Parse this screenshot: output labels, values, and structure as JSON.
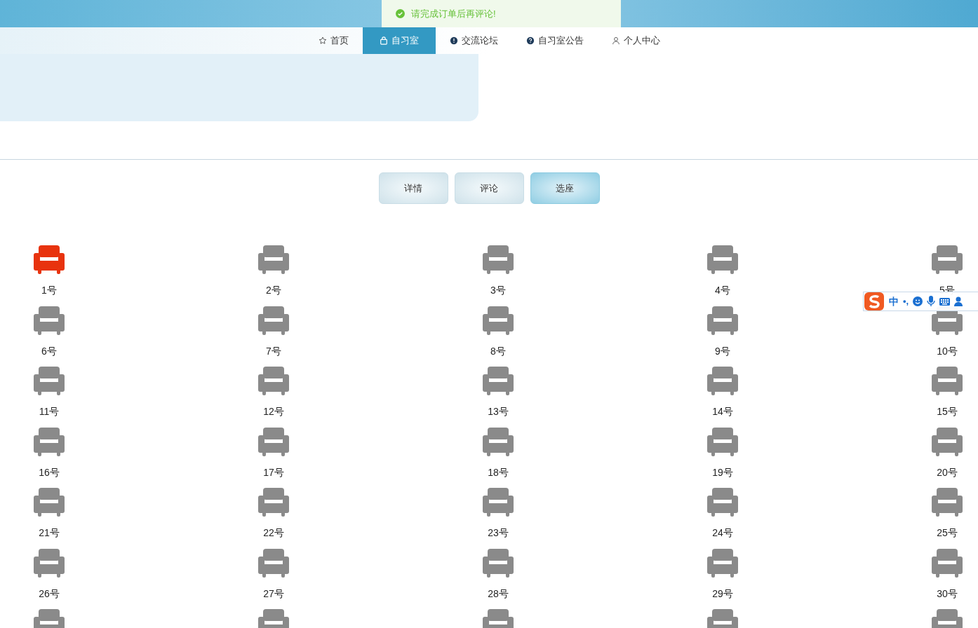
{
  "toast": {
    "message": "请完成订单后再评论!"
  },
  "nav": [
    {
      "label": "首页",
      "kind": "star",
      "selected": false
    },
    {
      "label": "自习室",
      "kind": "bag",
      "selected": true
    },
    {
      "label": "交流论坛",
      "kind": "alert",
      "selected": false
    },
    {
      "label": "自习室公告",
      "kind": "help",
      "selected": false
    },
    {
      "label": "个人中心",
      "kind": "user",
      "selected": false
    }
  ],
  "tabs": [
    {
      "label": "详情",
      "selected": false
    },
    {
      "label": "评论",
      "selected": false
    },
    {
      "label": "选座",
      "selected": true
    }
  ],
  "seats": [
    {
      "label": "1号",
      "selected": true
    },
    {
      "label": "2号",
      "selected": false
    },
    {
      "label": "3号",
      "selected": false
    },
    {
      "label": "4号",
      "selected": false
    },
    {
      "label": "5号",
      "selected": false
    },
    {
      "label": "6号",
      "selected": false
    },
    {
      "label": "7号",
      "selected": false
    },
    {
      "label": "8号",
      "selected": false
    },
    {
      "label": "9号",
      "selected": false
    },
    {
      "label": "10号",
      "selected": false
    },
    {
      "label": "11号",
      "selected": false
    },
    {
      "label": "12号",
      "selected": false
    },
    {
      "label": "13号",
      "selected": false
    },
    {
      "label": "14号",
      "selected": false
    },
    {
      "label": "15号",
      "selected": false
    },
    {
      "label": "16号",
      "selected": false
    },
    {
      "label": "17号",
      "selected": false
    },
    {
      "label": "18号",
      "selected": false
    },
    {
      "label": "19号",
      "selected": false
    },
    {
      "label": "20号",
      "selected": false
    },
    {
      "label": "21号",
      "selected": false
    },
    {
      "label": "22号",
      "selected": false
    },
    {
      "label": "23号",
      "selected": false
    },
    {
      "label": "24号",
      "selected": false
    },
    {
      "label": "25号",
      "selected": false
    },
    {
      "label": "26号",
      "selected": false
    },
    {
      "label": "27号",
      "selected": false
    },
    {
      "label": "28号",
      "selected": false
    },
    {
      "label": "29号",
      "selected": false
    },
    {
      "label": "30号",
      "selected": false
    },
    {
      "selected": false
    },
    {
      "selected": false
    },
    {
      "selected": false
    },
    {
      "selected": false
    },
    {
      "selected": false
    }
  ],
  "ime_toolbar": {
    "mode": "中",
    "punctuation": "•,"
  }
}
